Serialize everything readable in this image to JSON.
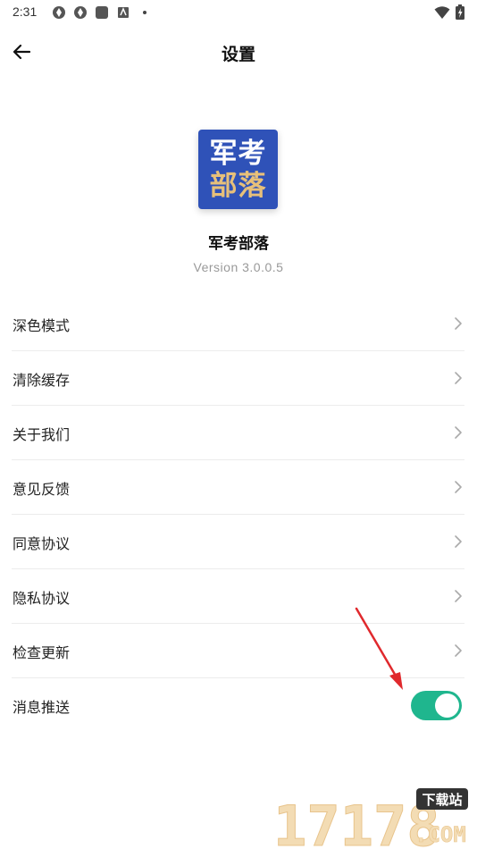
{
  "status_bar": {
    "time": "2:31"
  },
  "header": {
    "title": "设置"
  },
  "app": {
    "logo_line1": "军考",
    "logo_line2": "部落",
    "name": "军考部落",
    "version": "Version 3.0.0.5"
  },
  "settings": {
    "items": [
      {
        "label": "深色模式"
      },
      {
        "label": "清除缓存"
      },
      {
        "label": "关于我们"
      },
      {
        "label": "意见反馈"
      },
      {
        "label": "同意协议"
      },
      {
        "label": "隐私协议"
      },
      {
        "label": "检查更新"
      },
      {
        "label": "消息推送"
      }
    ],
    "push_enabled": true
  },
  "watermark": {
    "number": "17178",
    "badge": "下载站",
    "domain": ".COM"
  },
  "colors": {
    "logo_bg": "#2f52b8",
    "logo_gold": "#e7c07a",
    "toggle_on": "#1fb68e",
    "arrow": "#e0292d"
  },
  "icons": {
    "back": "arrow-left-icon",
    "chevron": "chevron-right-icon",
    "wifi": "wifi-icon",
    "battery": "battery-icon"
  }
}
